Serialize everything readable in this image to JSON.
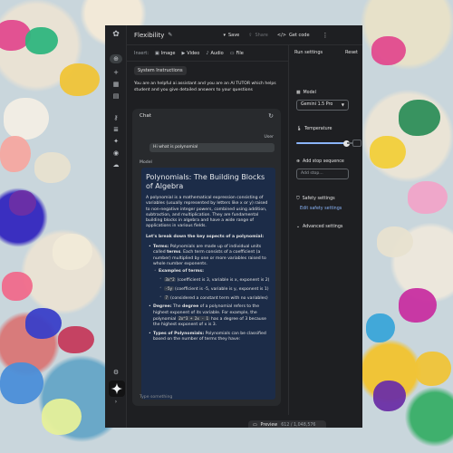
{
  "app": {
    "title": "Flexibility"
  },
  "toolbar": {
    "save": "Save",
    "share": "Share",
    "get_code": "Get code",
    "more": "⋮"
  },
  "insert": {
    "label": "Insert:",
    "options": [
      "Image",
      "Video",
      "Audio",
      "File"
    ]
  },
  "system_instructions": {
    "chip": "System Instructions",
    "text": "You are an helpful ai assistant and you are an AI TUTOR which helps student and you give detailed answers to your questions"
  },
  "chat": {
    "title": "Chat",
    "user_role": "User",
    "user_message": "Hi what is polynomial",
    "model_role": "Model",
    "response": {
      "heading": "Polynomials: The Building Blocks of Algebra",
      "intro": "A polynomial is a mathematical expression consisting of variables (usually represented by letters like x or y) raised to non-negative integer powers, combined using addition, subtraction, and multiplication. They are fundamental building blocks in algebra and have a wide range of applications in various fields.",
      "key_aspects": "Let's break down the key aspects of a polynomial:",
      "terms_label": "Terms:",
      "terms_text_1": "Polynomials are made up of individual units called",
      "terms_word": "terms",
      "terms_text_2": ". Each term consists of a coefficient (a number) multiplied by one or more variables raised to whole number exponents.",
      "examples_label": "Examples of terms:",
      "ex1_code": "3x^2",
      "ex1_text": "(coefficient is 3, variable is x, exponent is 2)",
      "ex2_code": "-5y",
      "ex2_text": "(coefficient is -5, variable is y, exponent is 1)",
      "ex3_code": "7",
      "ex3_text": "(considered a constant term with no variables)",
      "degree_label": "Degree:",
      "degree_text_1": "The",
      "degree_word": "degree",
      "degree_text_2": "of a polynomial refers to the highest exponent of its variable. For example, the polynomial",
      "degree_code": "2x^3 + 2x - 1",
      "degree_text_3": "has a degree of 3 because the highest exponent of x is 3.",
      "types_label": "Types of Polynomials:",
      "types_text": "Polynomials can be classified based on the number of terms they have:"
    },
    "input_placeholder": "Type something"
  },
  "preview": {
    "label": "Preview",
    "tokens": "612 / 1,048,576"
  },
  "run_settings": {
    "title": "Run settings",
    "reset": "Reset",
    "model_label": "Model",
    "model_value": "Gemini 1.5 Pro",
    "temperature_label": "Temperature",
    "temperature_level": 0.9,
    "stop_label": "Add stop sequence",
    "stop_placeholder": "Add stop...",
    "safety_label": "Safety settings",
    "safety_link": "Edit safety settings",
    "advanced_label": "Advanced settings"
  },
  "colors": {
    "panel": "#1e1f22",
    "model_card": "#1c2c48",
    "accent": "#8ab4f8"
  }
}
